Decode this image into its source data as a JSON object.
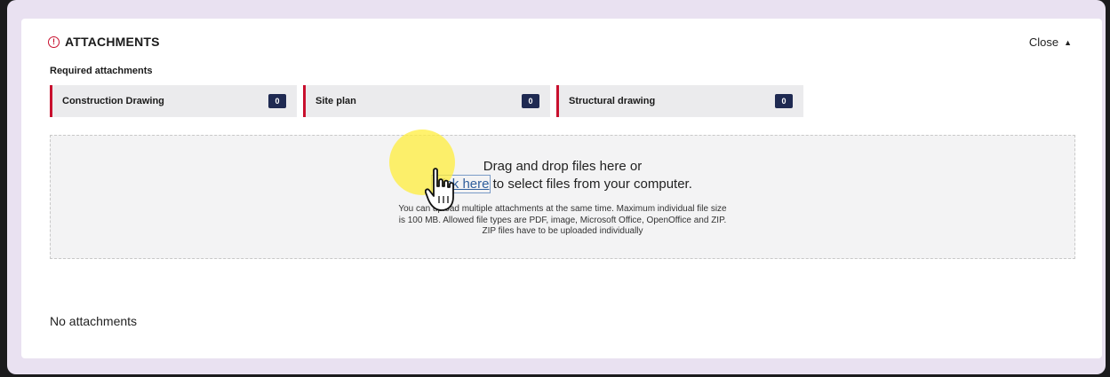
{
  "panel": {
    "title": "ATTACHMENTS",
    "close_label": "Close",
    "required_label": "Required attachments",
    "required_items": [
      {
        "label": "Construction Drawing",
        "count": "0"
      },
      {
        "label": "Site plan",
        "count": "0"
      },
      {
        "label": "Structural drawing",
        "count": "0"
      }
    ]
  },
  "dropzone": {
    "line1": "Drag and drop files here or",
    "link": "click here",
    "line2_rest": " to select files from your computer.",
    "help1": "You can upload multiple attachments at the same time. Maximum individual file size",
    "help2": "is 100 MB. Allowed file types are PDF, image, Microsoft Office, OpenOffice and ZIP.",
    "help3": "ZIP files have to be uploaded individually"
  },
  "empty_state": "No attachments",
  "colors": {
    "accent_red": "#c8102e",
    "badge_navy": "#1f2a52",
    "link_blue": "#2f5e9c",
    "frame_lavender": "#e9e1f1"
  },
  "icons": {
    "header": "warning-circle-icon",
    "close": "chevron-up-icon",
    "pointer": "hand-pointer-icon"
  }
}
